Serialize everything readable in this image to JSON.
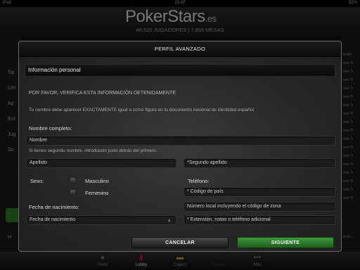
{
  "status_bar": {
    "carrier": "iPad",
    "time": "23:47",
    "battery": "52%"
  },
  "header": {
    "logo_main": "PokerStars",
    "logo_tld": ".es",
    "stats": "46.520 JUGADORES   |   7.856 MESAS"
  },
  "background_left": [
    "Tip",
    "Lím",
    "Ap",
    "Ent",
    "Jug",
    "Oc",
    "H"
  ],
  "background_right": [
    "imito",
    "ede 9",
    "ede 9",
    "ede 9",
    "ede 9",
    "ede 9",
    "ede 9",
    "ede 9",
    "ede 9",
    "ede 9",
    "ede 9",
    "ede 9",
    "ede 9",
    "ede 9",
    "ede 9",
    "ede 9",
    "ede 9",
    "ede 9",
    "imito"
  ],
  "modal": {
    "title": "PERFIL AVANZADO",
    "section_title": "Información personal",
    "verify_text": "POR FAVOR, VERIFICA ESTA INFORMACIÓN DETENIDAMENTE",
    "exact_name_text": "Tu nombre debe aparecer EXACTAMENTE igual a como figura en tu documento nacional de identidad español.",
    "full_name_label": "Nombre completo:",
    "first_name_placeholder": "Nombre",
    "middle_name_hint": "Si tienes segundo nombre, introdúcelo justo detrás del primero.",
    "surname_placeholder": "Apellido",
    "second_surname_placeholder": "*Segundo apellido",
    "sex_label": "Sexo:",
    "male_label": "Masculino",
    "female_label": "Femenino",
    "phone_label": "Teléfono:",
    "country_code_placeholder": "* Código de país",
    "local_number_placeholder": "Número local incluyendo el código de zona",
    "dob_label": "Fecha de nacimiento:",
    "dob_placeholder": "Fecha de nacimiento",
    "extension_placeholder": "* Extensión, notas o teléfono adicional",
    "cancel_label": "CANCELAR",
    "next_label": "SIGUIENTE"
  },
  "tabs": [
    {
      "label": "Inicio",
      "icon": "spade-icon"
    },
    {
      "label": "Lobby",
      "icon": "lobby-cards-icon"
    },
    {
      "label": "Cajero",
      "icon": "cashier-icon"
    },
    {
      "label": "Mesas",
      "icon": "table-icon"
    },
    {
      "label": "Más",
      "icon": "more-dots-icon"
    }
  ],
  "colors": {
    "accent_red": "#c8102e",
    "next_green": "#2e7d2e"
  }
}
